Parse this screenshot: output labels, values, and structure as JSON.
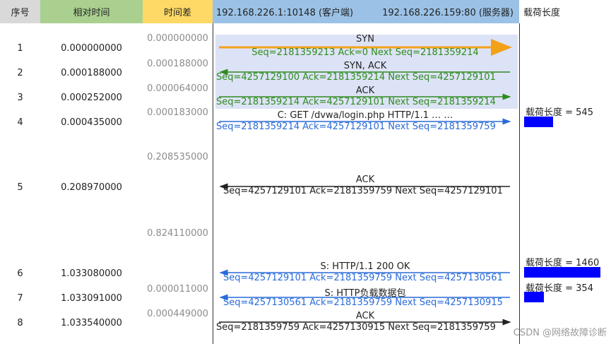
{
  "header": {
    "seq": "序号",
    "rel_time": "相对时间",
    "delta": "时间差",
    "client": "192.168.226.1:10148 (客户端)",
    "server": "192.168.226.159:80 (服务器)",
    "payload": "载荷长度"
  },
  "rows": [
    {
      "no": "1",
      "time": "0.000000000"
    },
    {
      "no": "2",
      "time": "0.000188000"
    },
    {
      "no": "3",
      "time": "0.000252000"
    },
    {
      "no": "4",
      "time": "0.000435000"
    },
    {
      "no": "5",
      "time": "0.208970000"
    },
    {
      "no": "6",
      "time": "1.033080000"
    },
    {
      "no": "7",
      "time": "1.033091000"
    },
    {
      "no": "8",
      "time": "1.033540000"
    }
  ],
  "deltas": [
    "0.000000000",
    "0.000188000",
    "0.000064000",
    "0.000183000",
    "0.208535000",
    "0.824110000",
    "0.000011000",
    "0.000449000"
  ],
  "packets": [
    {
      "label": "SYN",
      "detail": "Seq=2181359213  Ack=0  Next Seq=2181359214",
      "dir": "right",
      "color": "#f4a11a"
    },
    {
      "label": "SYN, ACK",
      "detail": "Seq=4257129100  Ack=2181359214  Next Seq=4257129101",
      "dir": "left",
      "color": "#2e8b1f"
    },
    {
      "label": "ACK",
      "detail": "Seq=2181359214  Ack=4257129101  Next Seq=2181359214",
      "dir": "right",
      "color": "#2e8b1f"
    },
    {
      "label": "C: GET /dvwa/login.php HTTP/1.1  … …",
      "detail": "Seq=2181359214  Ack=4257129101  Next Seq=2181359759",
      "dir": "right",
      "color": "#2a6bd8"
    },
    {
      "label": "ACK",
      "detail": "Seq=4257129101  Ack=2181359759  Next Seq=4257129101",
      "dir": "left",
      "color": "#222222"
    },
    {
      "label": "S: HTTP/1.1 200 OK",
      "detail": "Seq=4257129101  Ack=2181359759  Next Seq=4257130561",
      "dir": "left",
      "color": "#2a6bd8"
    },
    {
      "label": "S: HTTP负载数据包",
      "detail": "Seq=4257130561  Ack=2181359759  Next Seq=4257130915",
      "dir": "left",
      "color": "#2a6bd8"
    },
    {
      "label": "ACK",
      "detail": "Seq=2181359759  Ack=4257130915  Next Seq=2181359759",
      "dir": "right",
      "color": "#222222"
    }
  ],
  "payloads": [
    {
      "label": "载荷长度 = 545",
      "value": 545
    },
    {
      "label": "载荷长度 = 1460",
      "value": 1460
    },
    {
      "label": "载荷长度 = 354",
      "value": 354
    }
  ],
  "watermark": "CSDN @网络故障诊断"
}
